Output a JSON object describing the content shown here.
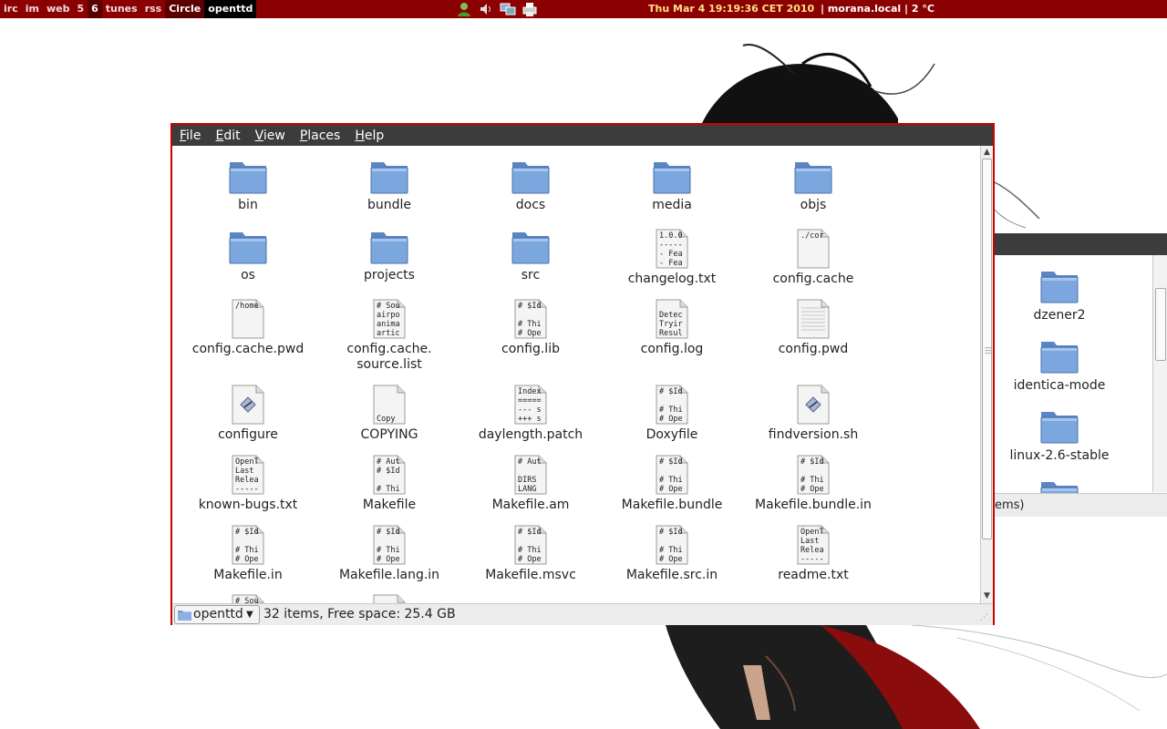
{
  "panel": {
    "tags": [
      {
        "label": "irc",
        "state": "normal"
      },
      {
        "label": "im",
        "state": "normal"
      },
      {
        "label": "web",
        "state": "normal"
      },
      {
        "label": "5",
        "state": "normal"
      },
      {
        "label": "6",
        "state": "active"
      },
      {
        "label": "tunes",
        "state": "normal"
      },
      {
        "label": "rss",
        "state": "normal"
      },
      {
        "label": "Circle",
        "state": "active"
      },
      {
        "label": "openttd",
        "state": "current"
      }
    ],
    "tray_icons": [
      "user-icon",
      "volume-icon",
      "network-icon",
      "printer-icon"
    ],
    "clock": "Thu Mar  4 19:19:36 CET 2010",
    "status": "| morana.local | 2 °C"
  },
  "main_window": {
    "menu": [
      "File",
      "Edit",
      "View",
      "Places",
      "Help"
    ],
    "items": [
      {
        "name": "bin",
        "type": "folder"
      },
      {
        "name": "bundle",
        "type": "folder"
      },
      {
        "name": "docs",
        "type": "folder"
      },
      {
        "name": "media",
        "type": "folder"
      },
      {
        "name": "objs",
        "type": "folder"
      },
      {
        "name": "os",
        "type": "folder"
      },
      {
        "name": "projects",
        "type": "folder"
      },
      {
        "name": "src",
        "type": "folder"
      },
      {
        "name": "changelog.txt",
        "type": "text",
        "preview": [
          "1.0.0",
          "-----",
          "- Fea",
          "- Fea"
        ]
      },
      {
        "name": "config.cache",
        "type": "text",
        "preview": [
          "./cor",
          "",
          "",
          ""
        ]
      },
      {
        "name": "config.cache.pwd",
        "type": "text",
        "preview": [
          "/home",
          "",
          "",
          ""
        ]
      },
      {
        "name": "config.cache.\nsource.list",
        "type": "text",
        "preview": [
          "# Sou",
          "airpo",
          "anima",
          "artic"
        ]
      },
      {
        "name": "config.lib",
        "type": "text",
        "preview": [
          "# $Id",
          "",
          "# Thi",
          "# Ope"
        ]
      },
      {
        "name": "config.log",
        "type": "text",
        "preview": [
          "",
          "Detec",
          "Tryir",
          "Resul"
        ]
      },
      {
        "name": "config.pwd",
        "type": "lines"
      },
      {
        "name": "configure",
        "type": "script"
      },
      {
        "name": "COPYING",
        "type": "text",
        "preview": [
          "",
          "",
          "",
          "Copy"
        ]
      },
      {
        "name": "daylength.patch",
        "type": "text",
        "preview": [
          "Index",
          "=====",
          "--- s",
          "+++ s"
        ]
      },
      {
        "name": "Doxyfile",
        "type": "text",
        "preview": [
          "# $Id",
          "",
          "# Thi",
          "# Ope"
        ]
      },
      {
        "name": "findversion.sh",
        "type": "script"
      },
      {
        "name": "known-bugs.txt",
        "type": "text",
        "preview": [
          "OpenT",
          "Last",
          "Relea",
          "-----"
        ]
      },
      {
        "name": "Makefile",
        "type": "text",
        "preview": [
          "# Aut",
          "# $Id",
          "",
          "# Thi"
        ]
      },
      {
        "name": "Makefile.am",
        "type": "text",
        "preview": [
          "# Aut",
          "",
          "DIRS",
          "LANG"
        ]
      },
      {
        "name": "Makefile.bundle",
        "type": "text",
        "preview": [
          "# $Id",
          "",
          "# Thi",
          "# Ope"
        ]
      },
      {
        "name": "Makefile.bundle.in",
        "type": "text",
        "preview": [
          "# $Id",
          "",
          "# Thi",
          "# Ope"
        ]
      },
      {
        "name": "Makefile.in",
        "type": "text",
        "preview": [
          "# $Id",
          "",
          "# Thi",
          "# Ope"
        ]
      },
      {
        "name": "Makefile.lang.in",
        "type": "text",
        "preview": [
          "# $Id",
          "",
          "# Thi",
          "# Ope"
        ]
      },
      {
        "name": "Makefile.msvc",
        "type": "text",
        "preview": [
          "# $Id",
          "",
          "# Thi",
          "# Ope"
        ]
      },
      {
        "name": "Makefile.src.in",
        "type": "text",
        "preview": [
          "# $Id",
          "",
          "# Thi",
          "# Ope"
        ]
      },
      {
        "name": "readme.txt",
        "type": "text",
        "preview": [
          "OpenT",
          "Last",
          "Relea",
          "-----"
        ]
      },
      {
        "name": "",
        "type": "text",
        "preview": [
          "# Sou",
          "",
          "",
          ""
        ]
      },
      {
        "name": "",
        "type": "text",
        "preview": [
          "",
          "",
          "",
          ""
        ]
      }
    ],
    "location": "openttd",
    "status_text": "32 items, Free space: 25.4 GB"
  },
  "background_window": {
    "items": [
      "dzener2",
      "identica-mode",
      "linux-2.6-stable",
      ""
    ],
    "status_text": "ems)"
  },
  "colors": {
    "panel_bg": "#8b0000",
    "clock": "#ffe08a",
    "window_border": "#cc0000",
    "menubar_bg": "#3c3c3c",
    "folder_blue": "#6f9ad6"
  }
}
